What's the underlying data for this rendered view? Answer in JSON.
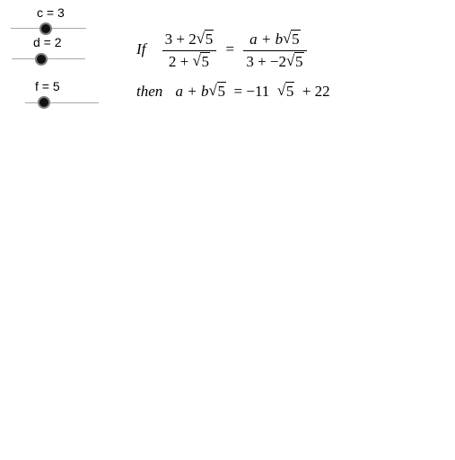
{
  "sliders": [
    {
      "label": "c = 3"
    },
    {
      "label": "d = 2"
    },
    {
      "label": "f = 5"
    }
  ],
  "equation": {
    "if_word": "If",
    "lhs_num_a": "3 + 2",
    "lhs_num_rad": "5",
    "lhs_den_a": "2 + ",
    "lhs_den_rad": "5",
    "equals": "=",
    "rhs_num_a": "a + b",
    "rhs_num_rad": "5",
    "rhs_den_a": "3 + −2",
    "rhs_den_rad": "5"
  },
  "result": {
    "then_word": "then",
    "expr_a": "a + b",
    "expr_rad": "5",
    "equals": " = −11 ",
    "ans_rad": "5",
    "tail": " + 22"
  }
}
